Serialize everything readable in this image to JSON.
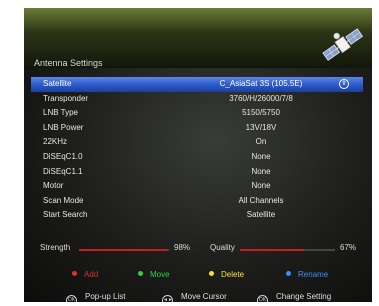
{
  "window": {
    "title": "Antenna Settings"
  },
  "menu": {
    "rows": [
      {
        "label": "Satellite",
        "value": "C_AsiaSat 3S (105.5E)",
        "selected": true
      },
      {
        "label": "Transponder",
        "value": "3760/H/26000/7/8"
      },
      {
        "label": "LNB Type",
        "value": "5150/5750"
      },
      {
        "label": "LNB Power",
        "value": "13V/18V"
      },
      {
        "label": "22KHz",
        "value": "On"
      },
      {
        "label": "DiSEqC1.0",
        "value": "None"
      },
      {
        "label": "DiSEqC1.1",
        "value": "None"
      },
      {
        "label": "Motor",
        "value": "None"
      },
      {
        "label": "Scan Mode",
        "value": "All Channels"
      },
      {
        "label": "Start Search",
        "value": "Satellite"
      }
    ],
    "selected_arrow": "⇕"
  },
  "signal": {
    "strength_label": "Strength",
    "strength_value": "98%",
    "strength_level": 0.98,
    "quality_label": "Quality",
    "quality_value": "67%",
    "quality_level": 0.67,
    "bar_color": "#c42020"
  },
  "legend": [
    {
      "label": "Add",
      "color": "#e0302a"
    },
    {
      "label": "Move",
      "color": "#2fd33a"
    },
    {
      "label": "Delete",
      "color": "#f3e13a"
    },
    {
      "label": "Rename",
      "color": "#3a8ff0"
    }
  ],
  "hints": [
    {
      "key": "OK",
      "label": "Pop-up List"
    },
    {
      "key": "◄►",
      "label": "Move Cursor"
    },
    {
      "key": "OK",
      "label": "Change Setting"
    }
  ],
  "colors": {
    "highlight": "#2b58c8",
    "header_band": "#6a7c36"
  },
  "icons": {
    "satellite": "satellite-icon"
  }
}
